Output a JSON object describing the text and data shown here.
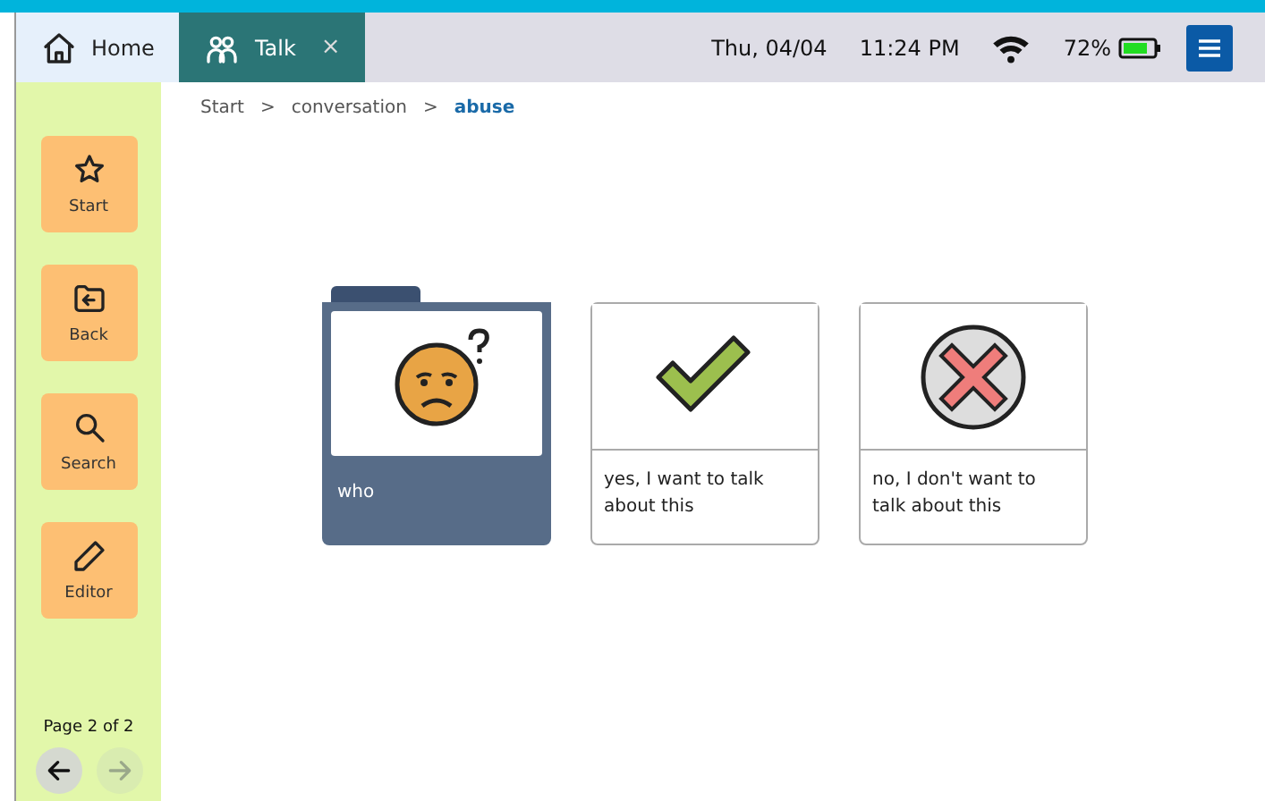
{
  "tabs": [
    {
      "label": "Home",
      "selected": false
    },
    {
      "label": "Talk",
      "selected": true,
      "close": "×"
    }
  ],
  "status": {
    "date": "Thu, 04/04",
    "time": "11:24 PM",
    "battery": "72%"
  },
  "sidebar": {
    "items": [
      {
        "label": "Start"
      },
      {
        "label": "Back"
      },
      {
        "label": "Search"
      },
      {
        "label": "Editor"
      }
    ],
    "page": "Page 2 of 2",
    "pager": [
      {
        "disabled": false
      },
      {
        "disabled": true
      }
    ]
  },
  "breadcrumb": [
    {
      "label": "Start",
      "selected": false
    },
    {
      "label": "conversation",
      "selected": false
    },
    {
      "label": "abuse",
      "selected": true
    }
  ],
  "breadcrumb_separator": ">",
  "tiles": [
    {
      "kind": "folder",
      "label": "who"
    },
    {
      "kind": "button",
      "label": "yes, I want to talk about this"
    },
    {
      "kind": "button",
      "label": "no, I don't want to talk about this"
    }
  ]
}
